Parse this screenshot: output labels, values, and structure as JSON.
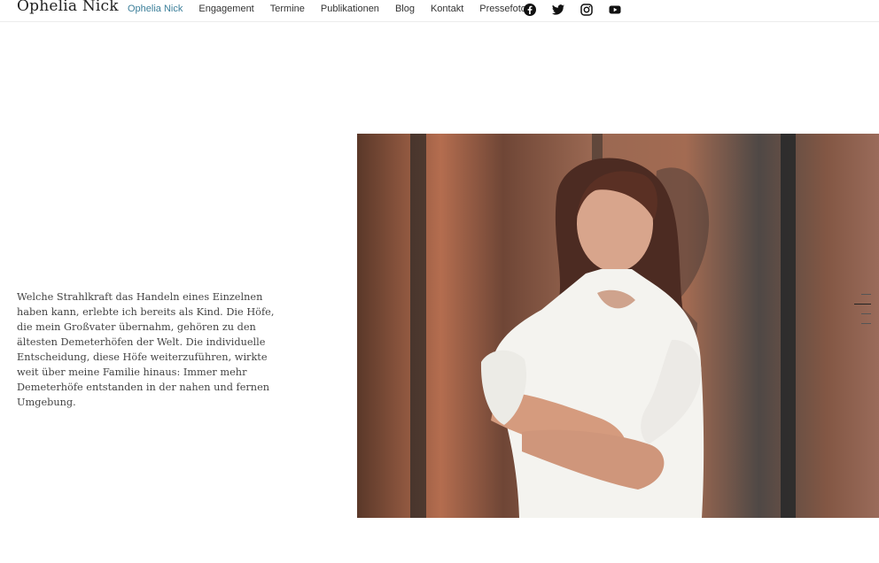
{
  "header": {
    "logo": "Ophelia Nick",
    "nav": [
      {
        "label": "Ophelia Nick",
        "active": true
      },
      {
        "label": "Engagement"
      },
      {
        "label": "Termine"
      },
      {
        "label": "Publikationen"
      },
      {
        "label": "Blog"
      },
      {
        "label": "Kontakt"
      },
      {
        "label": "Pressefotos"
      }
    ],
    "social": [
      "facebook-icon",
      "twitter-icon",
      "instagram-icon",
      "youtube-icon"
    ]
  },
  "main": {
    "intro": "Welche Strahlkraft das Handeln eines Einzelnen haben kann, erlebte ich bereits als Kind. Die Höfe, die mein Großvater übernahm, gehören zu den ältesten Demeterhöfen der Welt. Die individuelle Entscheidung, diese Höfe weiterzuführen, wirkte weit über meine Familie hinaus: Immer mehr Demeterhöfe entstanden in der nahen und fernen Umgebung."
  },
  "colors": {
    "accent": "#3c7f9a"
  }
}
